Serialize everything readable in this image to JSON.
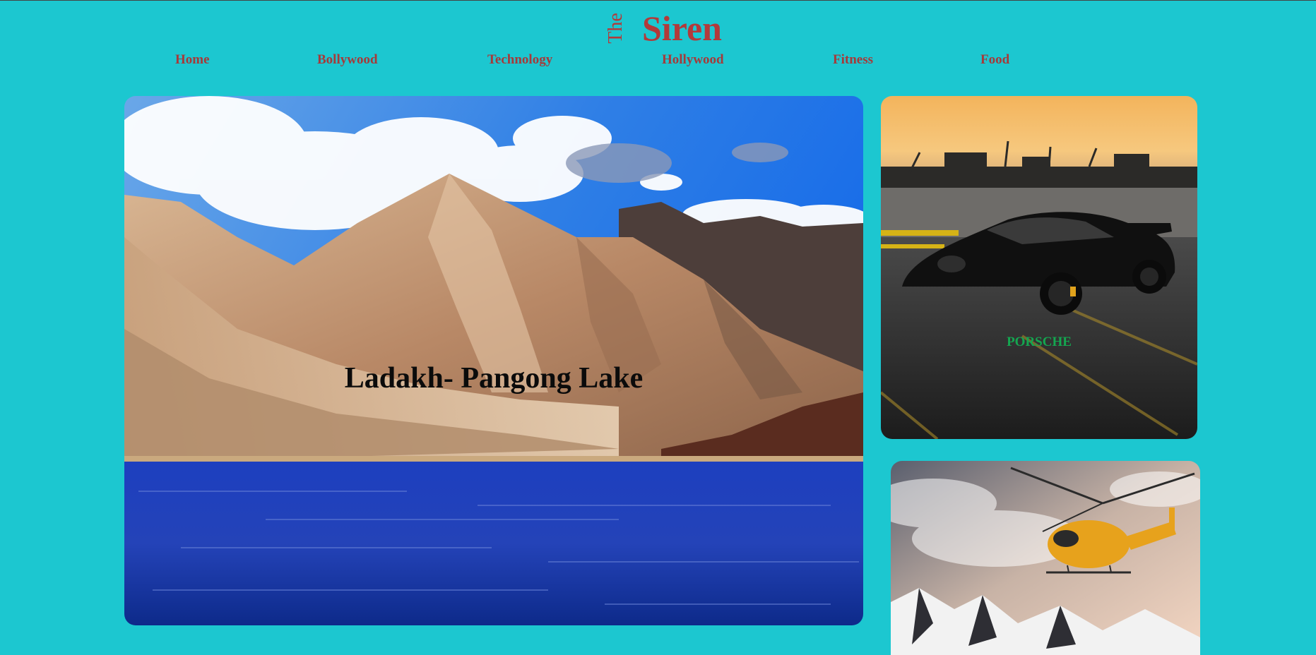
{
  "logo": {
    "the": "The",
    "name": "Siren"
  },
  "nav": {
    "items": [
      {
        "label": "Home"
      },
      {
        "label": "Bollywood"
      },
      {
        "label": "Technology"
      },
      {
        "label": "Hollywood"
      },
      {
        "label": "Fitness"
      },
      {
        "label": "Food"
      }
    ]
  },
  "hero": {
    "title": "Ladakh- Pangong Lake"
  },
  "side_cards": [
    {
      "label": "PORSCHE"
    },
    {
      "label": ""
    }
  ],
  "colors": {
    "background": "#1cc7d0",
    "brand": "#b23a3a",
    "nav_text": "#a53a3a",
    "card_label": "#14a650"
  }
}
